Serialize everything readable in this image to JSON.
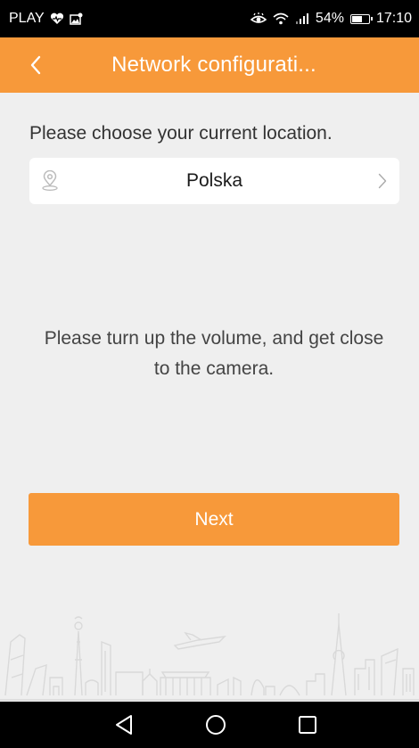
{
  "status_bar": {
    "carrier": "PLAY",
    "battery_percent": "54%",
    "time": "17:10"
  },
  "app_bar": {
    "title": "Network configurati..."
  },
  "location": {
    "prompt": "Please choose your current location.",
    "selected": "Polska"
  },
  "hint": "Please turn up the volume, and get close to the camera.",
  "next_label": "Next",
  "colors": {
    "accent": "#f7993a",
    "background": "#efefef"
  }
}
